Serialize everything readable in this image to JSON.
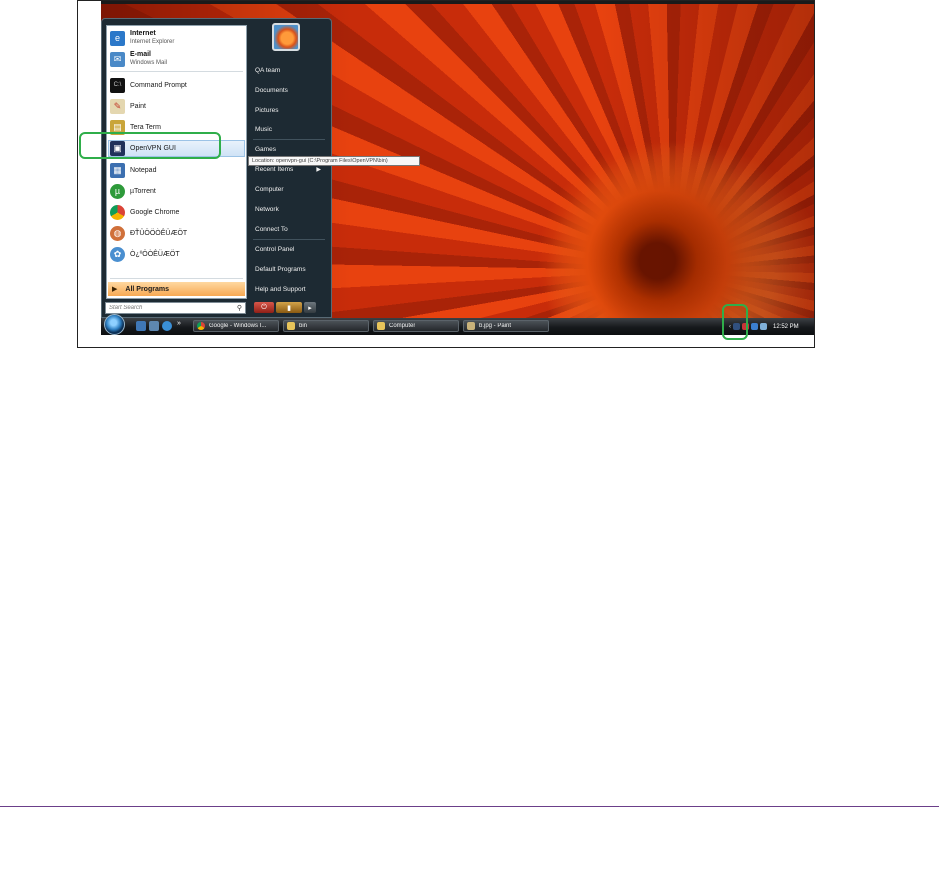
{
  "start_menu": {
    "pinned": [
      {
        "title": "Internet",
        "subtitle": "Internet Explorer",
        "icon": "internet-explorer-icon"
      },
      {
        "title": "E-mail",
        "subtitle": "Windows Mail",
        "icon": "windows-mail-icon"
      }
    ],
    "recent": [
      {
        "label": "Command Prompt",
        "icon": "command-prompt-icon"
      },
      {
        "label": "Paint",
        "icon": "paint-icon"
      },
      {
        "label": "Tera Term",
        "icon": "tera-term-icon"
      },
      {
        "label": "OpenVPN GUI",
        "icon": "openvpn-gui-icon"
      },
      {
        "label": "Notepad",
        "icon": "notepad-icon"
      },
      {
        "label": "µTorrent",
        "icon": "utorrent-icon"
      },
      {
        "label": "Google Chrome",
        "icon": "google-chrome-icon"
      },
      {
        "label": "ÐŤÛÖÖÒÊÜÆÖT",
        "icon": "app-icon"
      },
      {
        "label": "Ò¿ºÖÒÊÜÆÖT",
        "icon": "app-icon"
      }
    ],
    "all_programs": "All Programs",
    "search_placeholder": "Start Search",
    "right_items": [
      "QA team",
      "Documents",
      "Pictures",
      "Music",
      "Games",
      "Recent Items",
      "Computer",
      "Network",
      "Connect To",
      "Control Panel",
      "Default Programs",
      "Help and Support"
    ]
  },
  "tooltip": "Location: openvpn-gui (C:\\Program Files\\OpenVPN\\bin)",
  "taskbar": {
    "overflow": "»",
    "tasks": [
      {
        "label": "Google - Windows I...",
        "icon": "chrome-icon"
      },
      {
        "label": "bin",
        "icon": "folder-icon"
      },
      {
        "label": "Computer",
        "icon": "folder-icon"
      },
      {
        "label": "b.jpg - Paint",
        "icon": "paint-icon"
      }
    ],
    "clock": "12:52 PM"
  },
  "colors": {
    "highlight": "#2fae4a",
    "rule": "#6b3f8a"
  }
}
